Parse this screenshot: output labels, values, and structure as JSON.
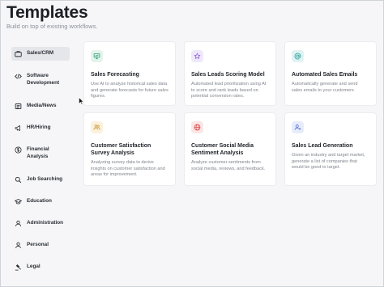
{
  "header": {
    "title": "Templates",
    "subtitle": "Build on top of existing workflows."
  },
  "sidebar": {
    "items": [
      {
        "label": "Sales/CRM",
        "icon": "briefcase-icon",
        "active": true
      },
      {
        "label": "Software Development",
        "icon": "code-icon",
        "active": false
      },
      {
        "label": "Media/News",
        "icon": "newspaper-icon",
        "active": false
      },
      {
        "label": "HR/Hiring",
        "icon": "megaphone-icon",
        "active": false
      },
      {
        "label": "Financial Analysis",
        "icon": "dollar-icon",
        "active": false
      },
      {
        "label": "Job Searching",
        "icon": "search-icon",
        "active": false
      },
      {
        "label": "Education",
        "icon": "graduation-cap-icon",
        "active": false
      },
      {
        "label": "Administration",
        "icon": "admin-icon",
        "active": false
      },
      {
        "label": "Personal",
        "icon": "user-icon",
        "active": false
      },
      {
        "label": "Legal",
        "icon": "gavel-icon",
        "active": false
      }
    ]
  },
  "cards": [
    {
      "title": "Sales Forecasting",
      "description": "Use AI to analyze historical sales data and generate forecasts for future sales figures.",
      "icon": "presentation-chart-icon",
      "icon_color": "#2f9e77",
      "icon_bg": "#e3f4ec"
    },
    {
      "title": "Sales Leads Scoring Model",
      "description": "Automated lead prioritization using AI to score and rank leads based on potential conversion rates.",
      "icon": "star-icon",
      "icon_color": "#8a5cd6",
      "icon_bg": "#efe8fb"
    },
    {
      "title": "Automated Sales Emails",
      "description": "Automatically generate and send sales emails to your customers",
      "icon": "at-sign-icon",
      "icon_color": "#2a9c9c",
      "icon_bg": "#e0f3f3"
    },
    {
      "title": "Customer Satisfaction Survey Analysis",
      "description": "Analyzing survey data to derive insights on customer satisfaction and areas for improvement.",
      "icon": "users-icon",
      "icon_color": "#c9952c",
      "icon_bg": "#fbf1dd"
    },
    {
      "title": "Customer Social Media Sentiment Analysis",
      "description": "Analyze customer sentiments from social media, reviews, and feedback.",
      "icon": "globe-icon",
      "icon_color": "#d64545",
      "icon_bg": "#fbe6e6"
    },
    {
      "title": "Sales Lead Generation",
      "description": "Given an industry and target market, generate a list of companies that would be good to target.",
      "icon": "user-plus-icon",
      "icon_color": "#4f6fd6",
      "icon_bg": "#e7ecfb"
    }
  ]
}
